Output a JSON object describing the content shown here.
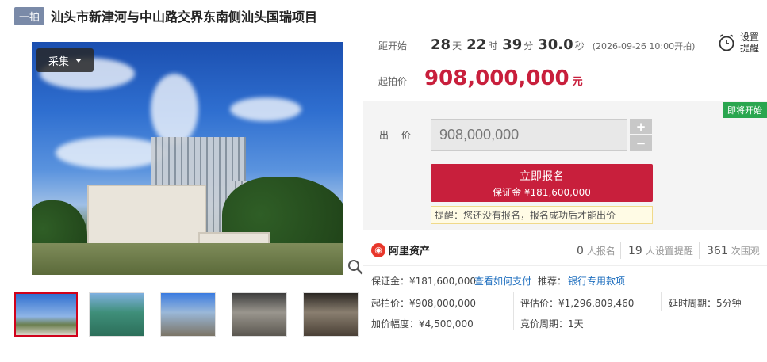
{
  "title": {
    "tag": "一拍",
    "text": "汕头市新津河与中山路交界东南侧汕头国瑞项目"
  },
  "gallery": {
    "collect_label": "采集",
    "thumb_count": 5
  },
  "countdown": {
    "label": "距开始",
    "days": "28",
    "days_unit": "天",
    "hours": "22",
    "hours_unit": "时",
    "minutes": "39",
    "minutes_unit": "分",
    "seconds": "30.0",
    "seconds_unit": "秒",
    "start_note": "(2026-09-26 10:00开拍)"
  },
  "remind": {
    "label": "设置提醒"
  },
  "start_price": {
    "label": "起拍价",
    "value": "908,000,000",
    "unit": "元"
  },
  "bid": {
    "badge": "即将开始",
    "label": "出 价",
    "value": "908,000,000",
    "plus": "+",
    "minus": "−",
    "signup_label": "立即报名",
    "deposit_line": "保证金 ¥181,600,000",
    "notice": "提醒：您还没有报名，报名成功后才能出价"
  },
  "stats": {
    "brand": "阿里资产",
    "signups_num": "0",
    "signups_label": "人报名",
    "reminders_num": "19",
    "reminders_label": "人设置提醒",
    "views_num": "361",
    "views_label": "次围观"
  },
  "details": {
    "deposit": "保证金：¥181,600,000",
    "how_to_pay": "查看如何支付",
    "recommend_label": "推荐：",
    "recommend_link": "银行专用款项",
    "start_price": "起拍价：¥908,000,000",
    "assessed": "评估价：¥1,296,809,460",
    "delay": "延时周期：5分钟",
    "increment": "加价幅度：¥4,500,000",
    "bid_period": "竞价周期：1天"
  },
  "colors": {
    "accent": "#c81f3c",
    "badge_green": "#2aa64f",
    "link_blue": "#1f6fbf"
  }
}
